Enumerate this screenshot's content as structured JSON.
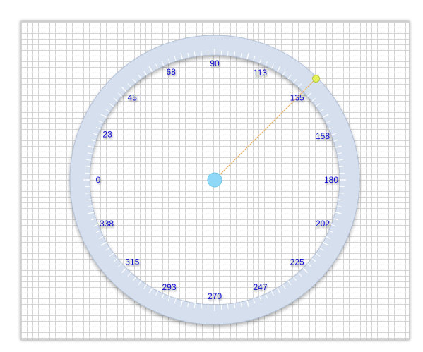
{
  "dial": {
    "labels": [
      {
        "text": "0",
        "angle": 0
      },
      {
        "text": "23",
        "angle": 23
      },
      {
        "text": "45",
        "angle": 45
      },
      {
        "text": "68",
        "angle": 68
      },
      {
        "text": "90",
        "angle": 90
      },
      {
        "text": "113",
        "angle": 113
      },
      {
        "text": "135",
        "angle": 135
      },
      {
        "text": "158",
        "angle": 158
      },
      {
        "text": "180",
        "angle": 180
      },
      {
        "text": "202",
        "angle": 202
      },
      {
        "text": "225",
        "angle": 225
      },
      {
        "text": "247",
        "angle": 247
      },
      {
        "text": "270",
        "angle": 270
      },
      {
        "text": "293",
        "angle": 293
      },
      {
        "text": "315",
        "angle": 315
      },
      {
        "text": "338",
        "angle": 338
      }
    ],
    "pointer_angle": 135,
    "colors": {
      "label": "#1010d0",
      "ring": "#d5dfee",
      "ring_edge": "#b4c2d8",
      "tick": "#ffffff",
      "center_knob": "#8fd8f8",
      "needle": "#e8b36a",
      "handle": "#e4f25a"
    }
  }
}
